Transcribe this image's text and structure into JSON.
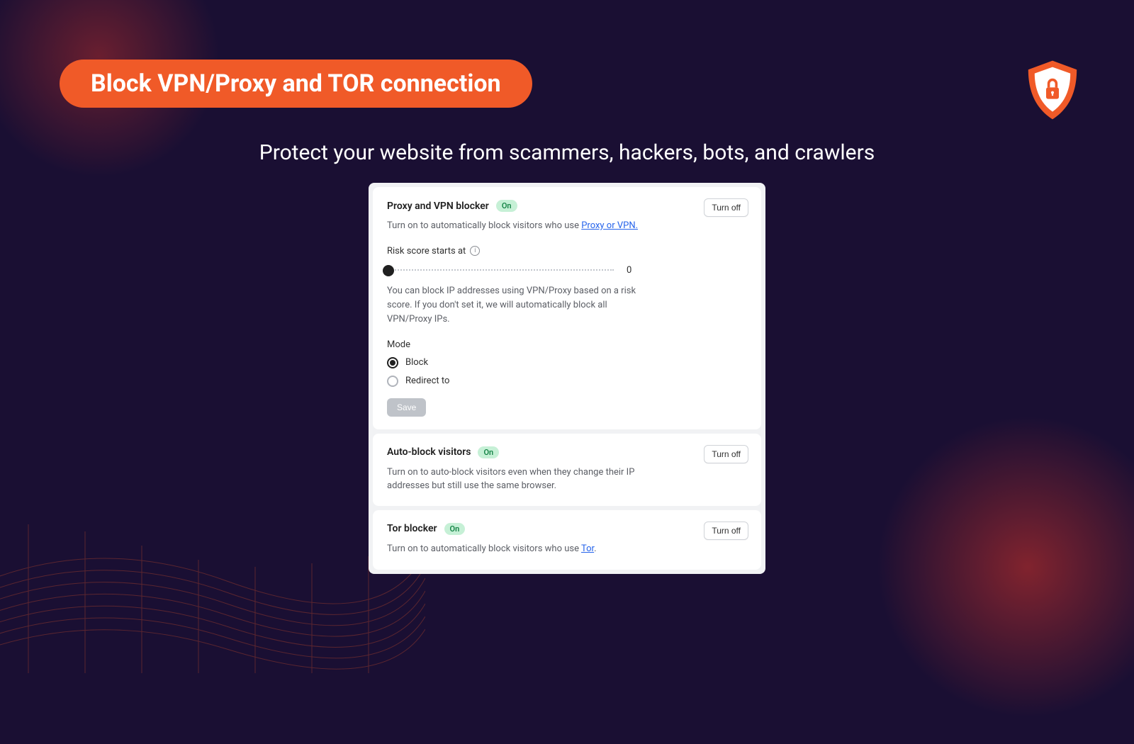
{
  "header": {
    "title": "Block VPN/Proxy and TOR connection",
    "subtitle": "Protect your website from scammers, hackers, bots, and crawlers"
  },
  "badges": {
    "on": "On"
  },
  "buttons": {
    "turn_off": "Turn off",
    "save": "Save"
  },
  "proxy_card": {
    "title": "Proxy and VPN blocker",
    "desc_prefix": "Turn on to automatically block visitors who use ",
    "desc_link": "Proxy or VPN.",
    "risk_label": "Risk score starts at",
    "slider_value": "0",
    "risk_help": "You can block IP addresses using VPN/Proxy based on a risk score. If you don't set it, we will automatically block all VPN/Proxy IPs.",
    "mode_label": "Mode",
    "mode_block": "Block",
    "mode_redirect": "Redirect to"
  },
  "auto_card": {
    "title": "Auto-block visitors",
    "desc": "Turn on to auto-block visitors even when they change their IP addresses but still use the same browser."
  },
  "tor_card": {
    "title": "Tor blocker",
    "desc_prefix": "Turn on to automatically block visitors who use ",
    "desc_link": "Tor",
    "desc_suffix": "."
  }
}
